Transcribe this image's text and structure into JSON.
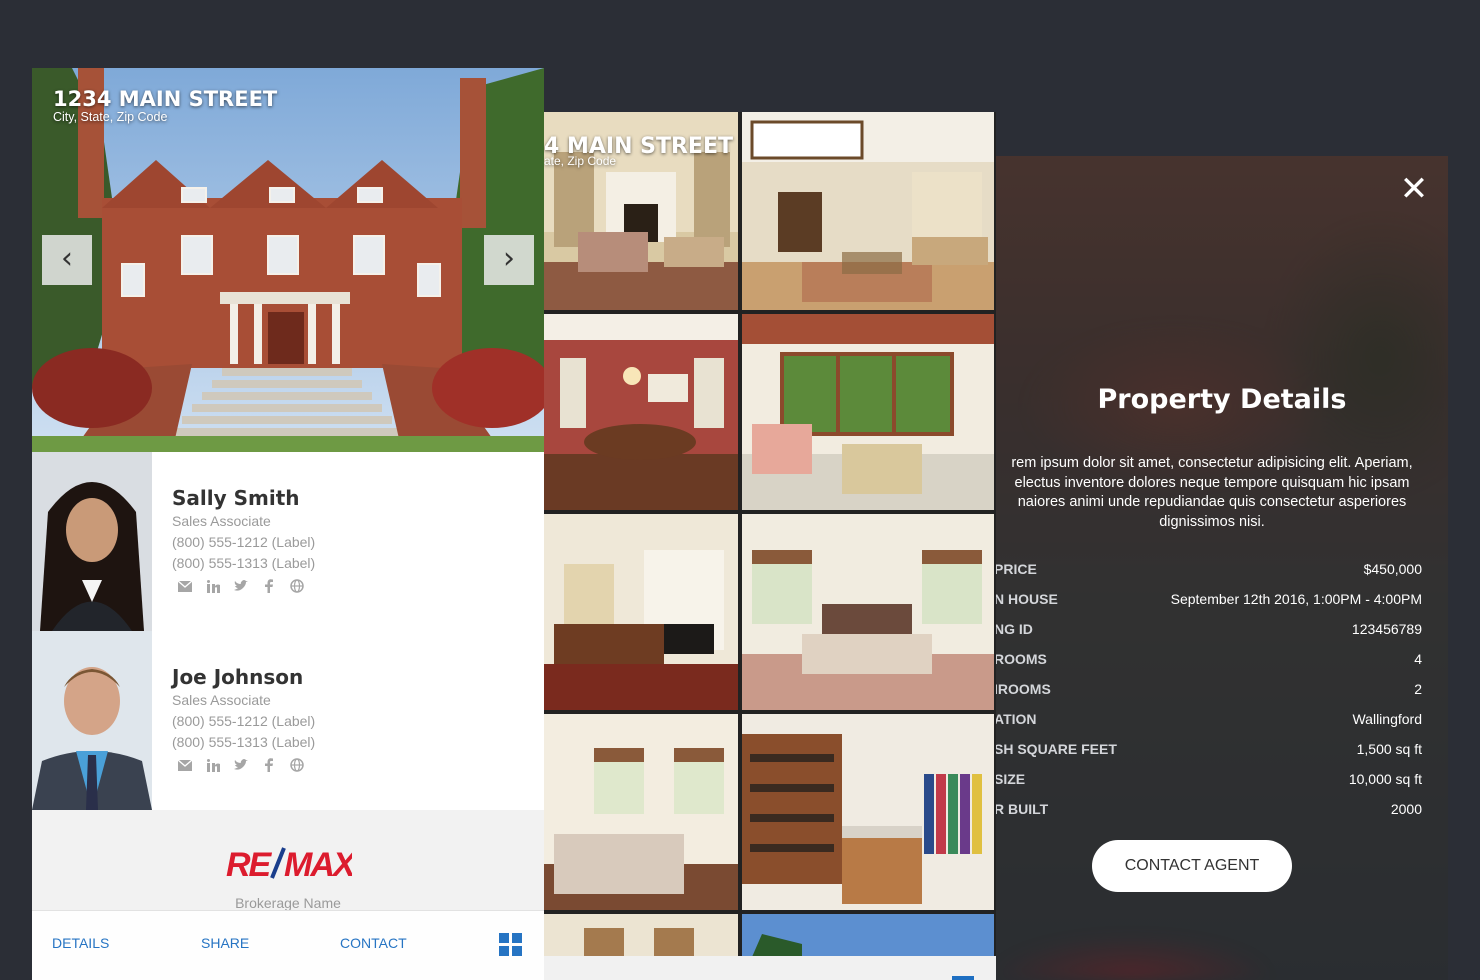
{
  "colors": {
    "accent": "#1e6fc2",
    "background": "#2b2e36",
    "remax_red": "#dc1c2e",
    "remax_blue": "#1a3e8c"
  },
  "card": {
    "address": "1234 MAIN STREET",
    "city_line": "City, State, Zip Code",
    "prev_icon": "‹",
    "next_icon": "›",
    "agents": [
      {
        "name": "Sally Smith",
        "role": "Sales Associate",
        "phone1": "(800) 555-1212 (Label)",
        "phone2": "(800) 555-1313 (Label)",
        "socials": [
          "email-icon",
          "linkedin-icon",
          "twitter-icon",
          "facebook-icon",
          "globe-icon"
        ]
      },
      {
        "name": "Joe Johnson",
        "role": "Sales Associate",
        "phone1": "(800) 555-1212 (Label)",
        "phone2": "(800) 555-1313 (Label)",
        "socials": [
          "email-icon",
          "linkedin-icon",
          "twitter-icon",
          "facebook-icon",
          "globe-icon"
        ]
      }
    ],
    "brokerage": {
      "logo_text": "RE/MAX",
      "name": "Brokerage Name"
    },
    "nav": {
      "details": "DETAILS",
      "share": "SHARE",
      "contact": "CONTACT",
      "grid_icon": "grid-icon"
    }
  },
  "gallery": {
    "address": "4 MAIN STREET",
    "city_line": "ate, Zip Code"
  },
  "details": {
    "close_icon": "✕",
    "title": "Property Details",
    "description_lines": [
      "rem ipsum dolor sit amet, consectetur adipisicing elit. Aperiam,",
      "electus inventore dolores neque tempore quisquam hic ipsam",
      "naiores animi unde repudiandae quis consectetur asperiores",
      "dignissimos nisi."
    ],
    "rows": [
      {
        "label": "PRICE",
        "value": "$450,000"
      },
      {
        "label": "N HOUSE",
        "value": "September 12th 2016, 1:00PM - 4:00PM"
      },
      {
        "label": "NG ID",
        "value": "123456789"
      },
      {
        "label": "ROOMS",
        "value": "4"
      },
      {
        "label": "IROOMS",
        "value": "2"
      },
      {
        "label": "ATION",
        "value": "Wallingford"
      },
      {
        "label": "SH SQUARE FEET",
        "value": "1,500 sq ft"
      },
      {
        "label": "SIZE",
        "value": "10,000 sq ft"
      },
      {
        "label": "R BUILT",
        "value": "2000"
      }
    ],
    "cta": "CONTACT AGENT"
  }
}
